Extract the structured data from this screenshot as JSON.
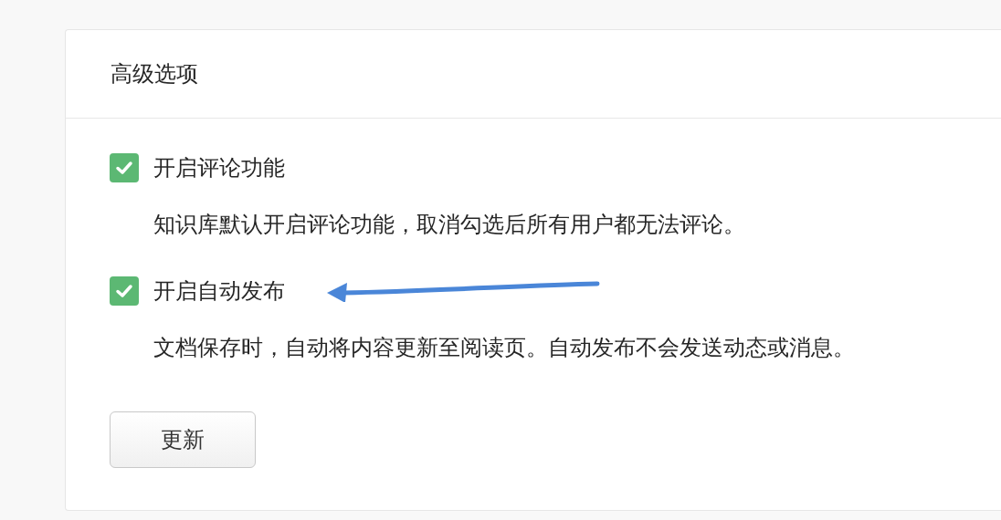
{
  "panel": {
    "title": "高级选项"
  },
  "options": [
    {
      "label": "开启评论功能",
      "checked": true,
      "description": "知识库默认开启评论功能，取消勾选后所有用户都无法评论。"
    },
    {
      "label": "开启自动发布",
      "checked": true,
      "description": "文档保存时，自动将内容更新至阅读页。自动发布不会发送动态或消息。"
    }
  ],
  "update_button": {
    "label": "更新"
  }
}
